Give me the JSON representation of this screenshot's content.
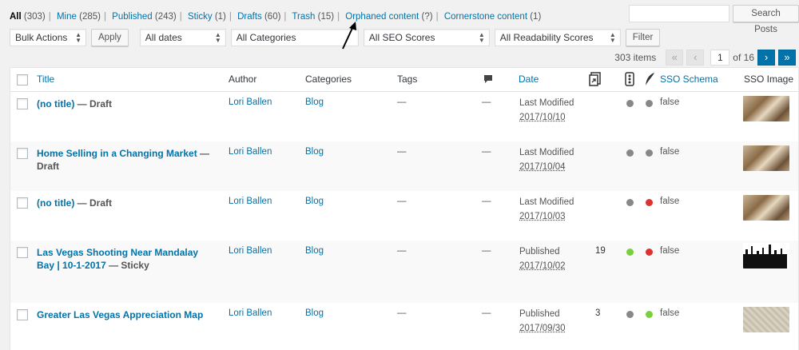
{
  "views": {
    "all": {
      "label": "All",
      "count": "(303)"
    },
    "mine": {
      "label": "Mine",
      "count": "(285)"
    },
    "published": {
      "label": "Published",
      "count": "(243)"
    },
    "sticky": {
      "label": "Sticky",
      "count": "(1)"
    },
    "drafts": {
      "label": "Drafts",
      "count": "(60)"
    },
    "trash": {
      "label": "Trash",
      "count": "(15)"
    },
    "orphaned": {
      "label": "Orphaned content",
      "count": "(?)"
    },
    "cornerstone": {
      "label": "Cornerstone content",
      "count": "(1)"
    }
  },
  "search": {
    "placeholder": "",
    "button": "Search Posts"
  },
  "bulk": {
    "select": "Bulk Actions",
    "apply": "Apply"
  },
  "filters": {
    "dates": "All dates",
    "categories": "All Categories",
    "seo": "All SEO Scores",
    "readability": "All Readability Scores",
    "button": "Filter"
  },
  "pagination": {
    "items": "303 items",
    "first": "«",
    "prev": "‹",
    "current": "1",
    "of": "of 16",
    "next": "›",
    "last": "»"
  },
  "columns": {
    "title": "Title",
    "author": "Author",
    "categories": "Categories",
    "tags": "Tags",
    "date": "Date",
    "sso_schema": "SSO Schema",
    "sso_image": "SSO Image"
  },
  "colors": {
    "green": "#7ad03a",
    "red": "#dc3232",
    "gray": "#888888",
    "link": "#0073aa"
  },
  "rows": [
    {
      "title": "(no title)",
      "state": " — Draft",
      "author": "Lori Ballen",
      "category": "Blog",
      "tags": "—",
      "comments": "—",
      "date_status": "Last Modified",
      "date": "2017/10/10",
      "links": "",
      "seo": "gray",
      "readability": "gray",
      "schema": "false"
    },
    {
      "title": "Home Selling in a Changing Market",
      "state": " — Draft",
      "author": "Lori Ballen",
      "category": "Blog",
      "tags": "—",
      "comments": "—",
      "date_status": "Last Modified",
      "date": "2017/10/04",
      "links": "",
      "seo": "gray",
      "readability": "gray",
      "schema": "false"
    },
    {
      "title": "(no title)",
      "state": " — Draft",
      "author": "Lori Ballen",
      "category": "Blog",
      "tags": "—",
      "comments": "—",
      "date_status": "Last Modified",
      "date": "2017/10/03",
      "links": "",
      "seo": "gray",
      "readability": "red",
      "schema": "false"
    },
    {
      "title": "Las Vegas Shooting Near Mandalay Bay | 10-1-2017",
      "state": " — Sticky",
      "author": "Lori Ballen",
      "category": "Blog",
      "tags": "—",
      "comments": "—",
      "date_status": "Published",
      "date": "2017/10/02",
      "links": "19",
      "seo": "green",
      "readability": "red",
      "schema": "false"
    },
    {
      "title": "Greater Las Vegas Appreciation Map",
      "state": "",
      "author": "Lori Ballen",
      "category": "Blog",
      "tags": "—",
      "comments": "—",
      "date_status": "Published",
      "date": "2017/09/30",
      "links": "3",
      "seo": "gray",
      "readability": "green",
      "schema": "false"
    }
  ]
}
